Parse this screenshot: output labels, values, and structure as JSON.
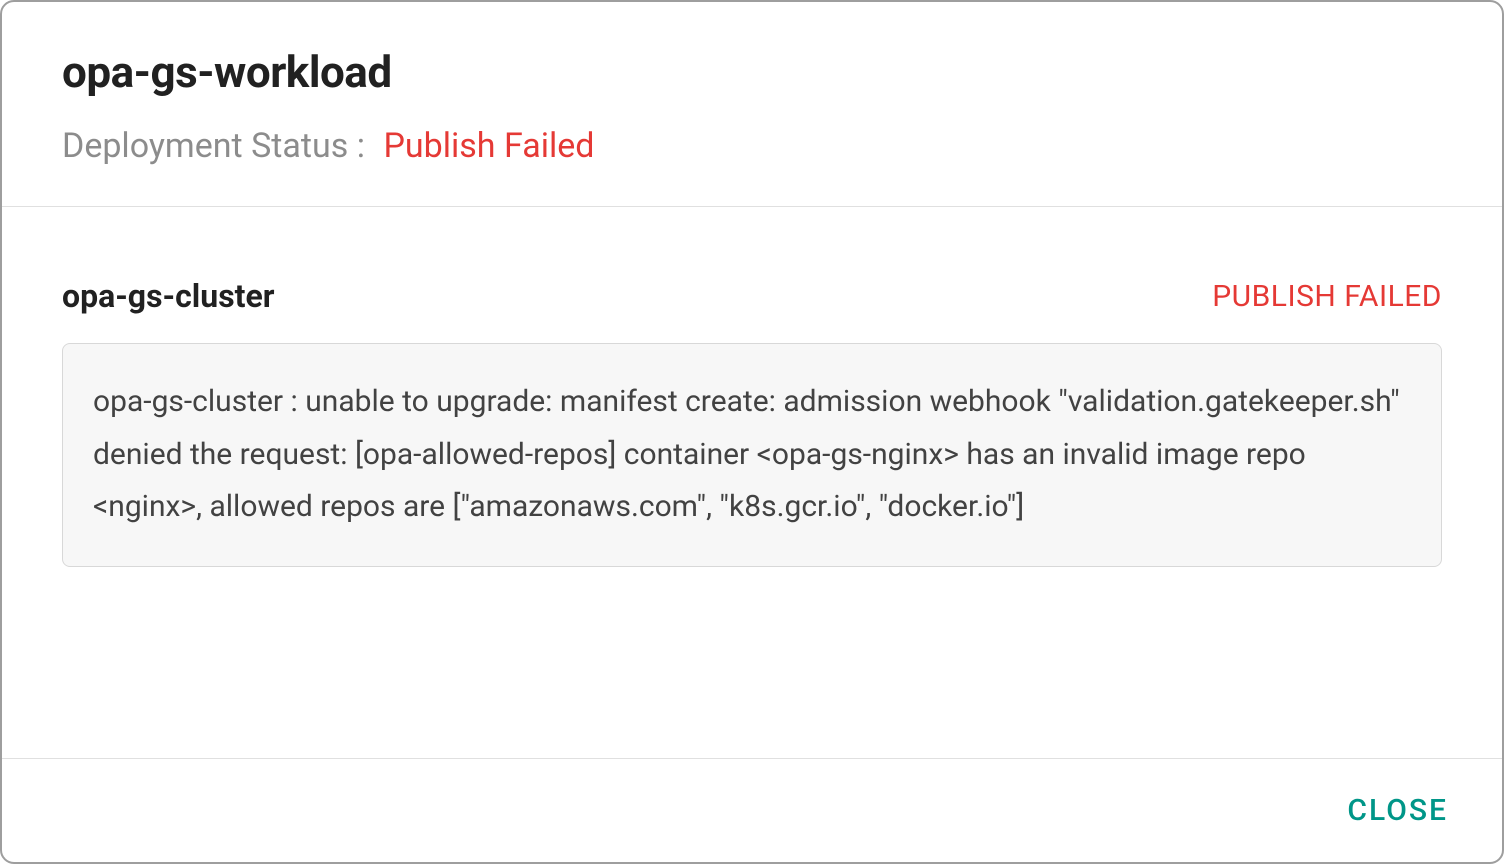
{
  "header": {
    "title": "opa-gs-workload",
    "status_label": "Deployment Status :",
    "status_value": "Publish Failed"
  },
  "body": {
    "cluster_name": "opa-gs-cluster",
    "cluster_status": "PUBLISH FAILED",
    "error_message": "opa-gs-cluster : unable to upgrade: manifest create: admission webhook \"validation.gatekeeper.sh\" denied the request: [opa-allowed-repos] container <opa-gs-nginx> has an invalid image repo <nginx>, allowed repos are [\"amazonaws.com\", \"k8s.gcr.io\", \"docker.io\"]"
  },
  "footer": {
    "close_label": "CLOSE"
  }
}
